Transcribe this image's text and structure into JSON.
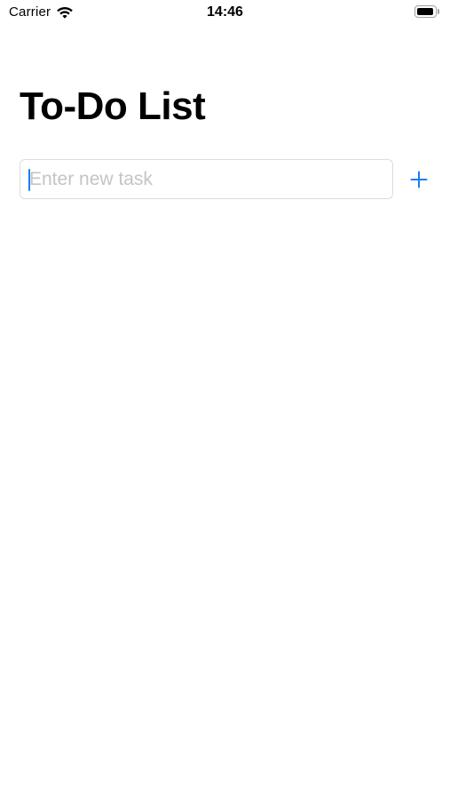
{
  "status_bar": {
    "carrier": "Carrier",
    "time": "14:46",
    "wifi_icon": "wifi-icon",
    "battery_icon": "battery-icon",
    "battery_level": 0.85
  },
  "header": {
    "title": "To-Do List"
  },
  "new_task": {
    "value": "",
    "placeholder": "Enter new task",
    "add_icon": "plus-icon"
  },
  "colors": {
    "accent": "#1a7cf5",
    "placeholder": "#c4c4c6",
    "field_border": "#dcdcdc",
    "background": "#ffffff"
  }
}
